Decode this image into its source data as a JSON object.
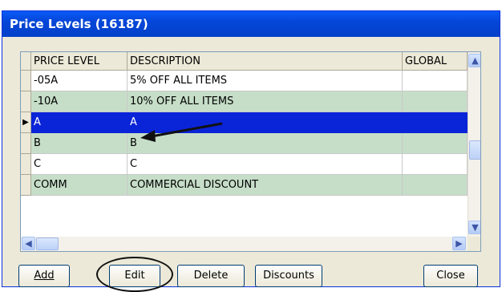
{
  "window": {
    "title": "Price Levels (16187)"
  },
  "grid": {
    "columns": [
      "PRICE LEVEL",
      "DESCRIPTION",
      "GLOBAL"
    ],
    "rows": [
      {
        "price_level": "-05A",
        "description": "5% OFF ALL ITEMS",
        "global": "",
        "bg": "#ffffff",
        "selected": false
      },
      {
        "price_level": "-10A",
        "description": "10% OFF ALL ITEMS",
        "global": "",
        "bg": "#c6dec8",
        "selected": false
      },
      {
        "price_level": "A",
        "description": "A",
        "global": "",
        "bg": "#0a24d8",
        "selected": true
      },
      {
        "price_level": "B",
        "description": "B",
        "global": "",
        "bg": "#c6dec8",
        "selected": false
      },
      {
        "price_level": "C",
        "description": "C",
        "global": "",
        "bg": "#ffffff",
        "selected": false
      },
      {
        "price_level": "COMM",
        "description": "COMMERCIAL DISCOUNT",
        "global": "",
        "bg": "#c6dec8",
        "selected": false
      }
    ],
    "current_row_indicator": "▶"
  },
  "buttons": {
    "add": "Add",
    "edit": "Edit",
    "delete": "Delete",
    "discounts": "Discounts",
    "close": "Close"
  },
  "icons": {
    "scroll_up": "up-arrow-icon",
    "scroll_down": "down-arrow-icon",
    "scroll_left": "left-arrow-icon",
    "scroll_right": "right-arrow-icon"
  }
}
